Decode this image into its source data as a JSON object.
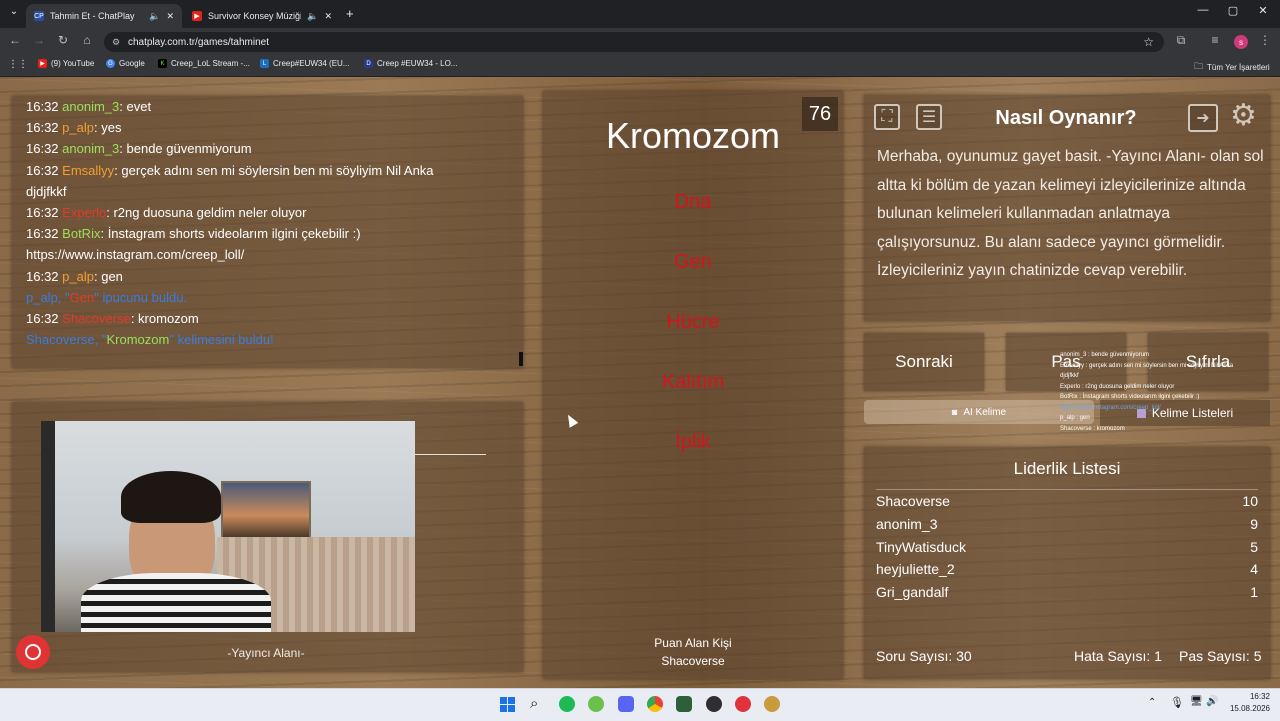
{
  "browser": {
    "tabs": [
      {
        "label": "Tahmin Et - ChatPlay",
        "favicon": "CP"
      },
      {
        "label": "Survivor Konsey Müziği (Uz",
        "favicon": "▶"
      }
    ],
    "url": "chatplay.com.tr/games/tahminet",
    "bookmarks": [
      "(9) YouTube",
      "Google",
      "Creep_LoL Stream -...",
      "Creep#EUW34 (EU...",
      "Creep #EUW34 - LO..."
    ],
    "all_bookmarks": "Tüm Yer İşaretleri",
    "profile_initial": "s"
  },
  "chat": {
    "lines": [
      {
        "time": "16:32",
        "user": "anonim_3",
        "msg": ": evet"
      },
      {
        "time": "16:32",
        "user": "p_alp",
        "msg": ": yes"
      },
      {
        "time": "16:32",
        "user": "anonim_3",
        "msg": ": bende güvenmiyorum"
      },
      {
        "time": "16:32",
        "user": "Emsallyy",
        "msg": ": gerçek adını sen mi söylersin ben mi söyliyim Nil Anka"
      },
      {
        "cont": "djdjfkkf"
      },
      {
        "time": "16:32",
        "user": "Experlo",
        "msg": ": r2ng duosuna geldim neler oluyor"
      },
      {
        "time": "16:32",
        "user": "BotRix",
        "msg": ": İnstagram shorts videolarım ilgini çekebilir :)"
      },
      {
        "cont": "https://www.instagram.com/creep_loll/"
      },
      {
        "time": "16:32",
        "user": "p_alp",
        "msg": ": gen"
      },
      {
        "system_a": "p_alp, \"",
        "system_b": "Gen",
        "system_c": "\" ipucunu buldu."
      },
      {
        "time": "16:32",
        "user": "Shacoverse",
        "msg": ": kromozom"
      },
      {
        "system_a": "Shacoverse, \"",
        "system_b": "Kromozom",
        "system_c": "\" kelimesini buldu!"
      }
    ]
  },
  "streamer": {
    "label": "-Yayıncı Alanı-"
  },
  "game": {
    "timer": "76",
    "word": "Kromozom",
    "forbidden": [
      "Dna",
      "Gen",
      "Hücre",
      "Kalıtım",
      "İplik"
    ],
    "scorer_label": "Puan Alan Kişi",
    "scorer": "Shacoverse"
  },
  "howto": {
    "title": "Nasıl Oynanır?",
    "text": "Merhaba, oyunumuz gayet basit. -Yayıncı Alanı- olan sol altta ki bölüm de yazan kelimeyi izleyicilerinize altında bulunan kelimeleri kullanmadan anlatmaya çalışıyorsunuz. Bu alanı sadece yayıncı görmelidir. İzleyicileriniz yayın chatinizde cevap verebilir."
  },
  "controls": {
    "next": "Sonraki",
    "pass": "Pas",
    "reset": "Sıfırla",
    "ai_word": "AI Kelime",
    "word_lists": "Kelime Listeleri"
  },
  "leaderboard": {
    "title": "Liderlik Listesi",
    "rows": [
      {
        "name": "Shacoverse",
        "score": "10"
      },
      {
        "name": "anonim_3",
        "score": "9"
      },
      {
        "name": "TinyWatisduck",
        "score": "5"
      },
      {
        "name": "heyjuliette_2",
        "score": "4"
      },
      {
        "name": "Gri_gandalf",
        "score": "1"
      }
    ],
    "questions": "Soru Sayısı: 30",
    "errors": "Hata Sayısı: 1",
    "passes": "Pas Sayısı: 5"
  },
  "overlay": [
    "anonim_3 : bende güvenmiyorum",
    "Emsallyy : gerçek adını sen mi söylersin ben mi söyliyim Nil Anka",
    "djdjfkkf",
    "Experlo : r2ng duosuna geldim neler oluyor",
    "BotRix : İnstagram shorts videolarım ilgini çekebilir :)",
    "https://www.instagram.com/creep_loll/",
    "p_alp : gen",
    "Shacoverse : kromozom"
  ],
  "taskbar": {
    "time": "16:32",
    "date": "15.08.2026"
  },
  "colors": {
    "forbidden": "#d2141c",
    "accent_green": "#9ae05a",
    "accent_orange": "#f0a030",
    "system_blue": "#3a7de0"
  }
}
